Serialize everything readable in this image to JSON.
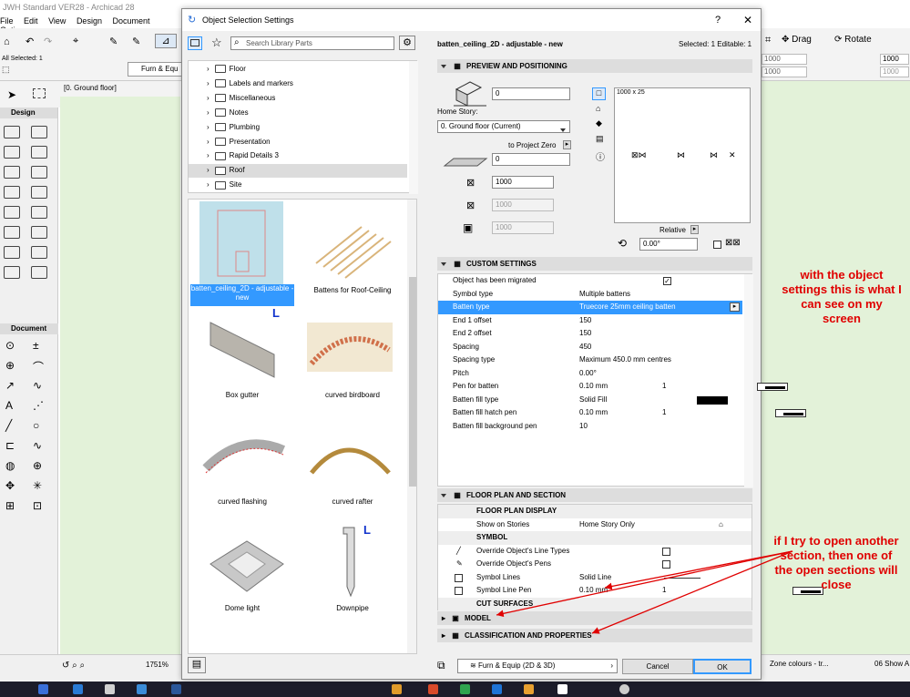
{
  "app": {
    "title": "JWH Standard VER28 - Archicad 28",
    "menus": [
      "File",
      "Edit",
      "View",
      "Design",
      "Document",
      "Options"
    ],
    "all_selected": "All Selected: 1",
    "story_tab": "[0. Ground floor]",
    "furn_label": "Furn & Equ",
    "toolbox_design": "Design",
    "toolbox_document": "Document",
    "drag_label": "Drag",
    "rotate_label": "Rotate",
    "right_field1": "1000",
    "right_field2": "1000",
    "right_field3": "1000",
    "right_field4": "1000",
    "zoom": "1751%",
    "status_zone": "Zone colours - tr...",
    "status_show": "06 Show A"
  },
  "dialog": {
    "title": "Object Selection Settings",
    "search_placeholder": "Search Library Parts",
    "object_name": "batten_ceiling_2D - adjustable - new",
    "selected_info": "Selected: 1 Editable: 1",
    "folders": [
      "Floor",
      "Labels and markers",
      "Miscellaneous",
      "Notes",
      "Plumbing",
      "Presentation",
      "Rapid Details 3",
      "Roof",
      "Site"
    ],
    "selected_folder": "Roof",
    "objects": [
      {
        "label": "batten_ceiling_2D - adjustable - new"
      },
      {
        "label": "Battens for Roof-Ceiling"
      },
      {
        "label": "Box gutter"
      },
      {
        "label": "curved birdboard"
      },
      {
        "label": "curved flashing"
      },
      {
        "label": "curved rafter"
      },
      {
        "label": "Dome light"
      },
      {
        "label": "Downpipe"
      }
    ],
    "preview": {
      "header": "PREVIEW AND POSITIONING",
      "elevation_value": "0",
      "home_story_label": "Home Story:",
      "home_story_value": "0. Ground floor (Current)",
      "to_project_zero": "to Project Zero",
      "zero_value": "0",
      "width_value": "1000",
      "depth_value": "1000",
      "height_value": "1000",
      "preview_dims": "1000 x 25",
      "relative_label": "Relative",
      "angle_value": "0.00°"
    },
    "custom": {
      "header": "CUSTOM SETTINGS",
      "rows": [
        {
          "name": "Object has been migrated",
          "value": "",
          "extra": "checkbox"
        },
        {
          "name": "Symbol type",
          "value": "Multiple battens",
          "extra": ""
        },
        {
          "name": "Batten type",
          "value": "Truecore 25mm ceiling batten",
          "extra": "selected"
        },
        {
          "name": "End 1 offset",
          "value": "150",
          "extra": ""
        },
        {
          "name": "End 2 offset",
          "value": "150",
          "extra": ""
        },
        {
          "name": "Spacing",
          "value": "450",
          "extra": ""
        },
        {
          "name": "Spacing type",
          "value": "Maximum 450.0 mm centres",
          "extra": ""
        },
        {
          "name": "Pitch",
          "value": "0.00°",
          "extra": ""
        },
        {
          "name": "Pen for batten",
          "value": "0.10 mm",
          "extra": "pen",
          "pen": "1"
        },
        {
          "name": "Batten fill type",
          "value": "Solid Fill",
          "extra": "fill"
        },
        {
          "name": "Batten fill hatch pen",
          "value": "0.10 mm",
          "extra": "pen",
          "pen": "1"
        },
        {
          "name": "Batten fill background pen",
          "value": "10",
          "extra": ""
        }
      ]
    },
    "floorplan": {
      "header": "FLOOR PLAN AND SECTION",
      "display_header": "FLOOR PLAN DISPLAY",
      "show_on_stories": "Show on Stories",
      "show_on_stories_value": "Home Story Only",
      "symbol_header": "SYMBOL",
      "override_lines": "Override Object's Line Types",
      "override_pens": "Override Object's Pens",
      "symbol_lines": "Symbol Lines",
      "symbol_lines_value": "Solid Line",
      "symbol_line_pen": "Symbol Line Pen",
      "symbol_line_pen_value": "0.10 mm",
      "symbol_line_pen_num": "1",
      "cut_surfaces": "CUT SURFACES"
    },
    "model_header": "MODEL",
    "classification_header": "CLASSIFICATION AND PROPERTIES",
    "layer_value": "Furn & Equip (2D & 3D)",
    "cancel": "Cancel",
    "ok": "OK"
  },
  "annotations": {
    "top": "with the object settings this is what I can see on my screen",
    "bottom": "if I try to open another section, then one of the open sections will close"
  },
  "colors": {
    "accent": "#3399ff",
    "annotation": "#e00000",
    "green": "#e3f2d9"
  }
}
